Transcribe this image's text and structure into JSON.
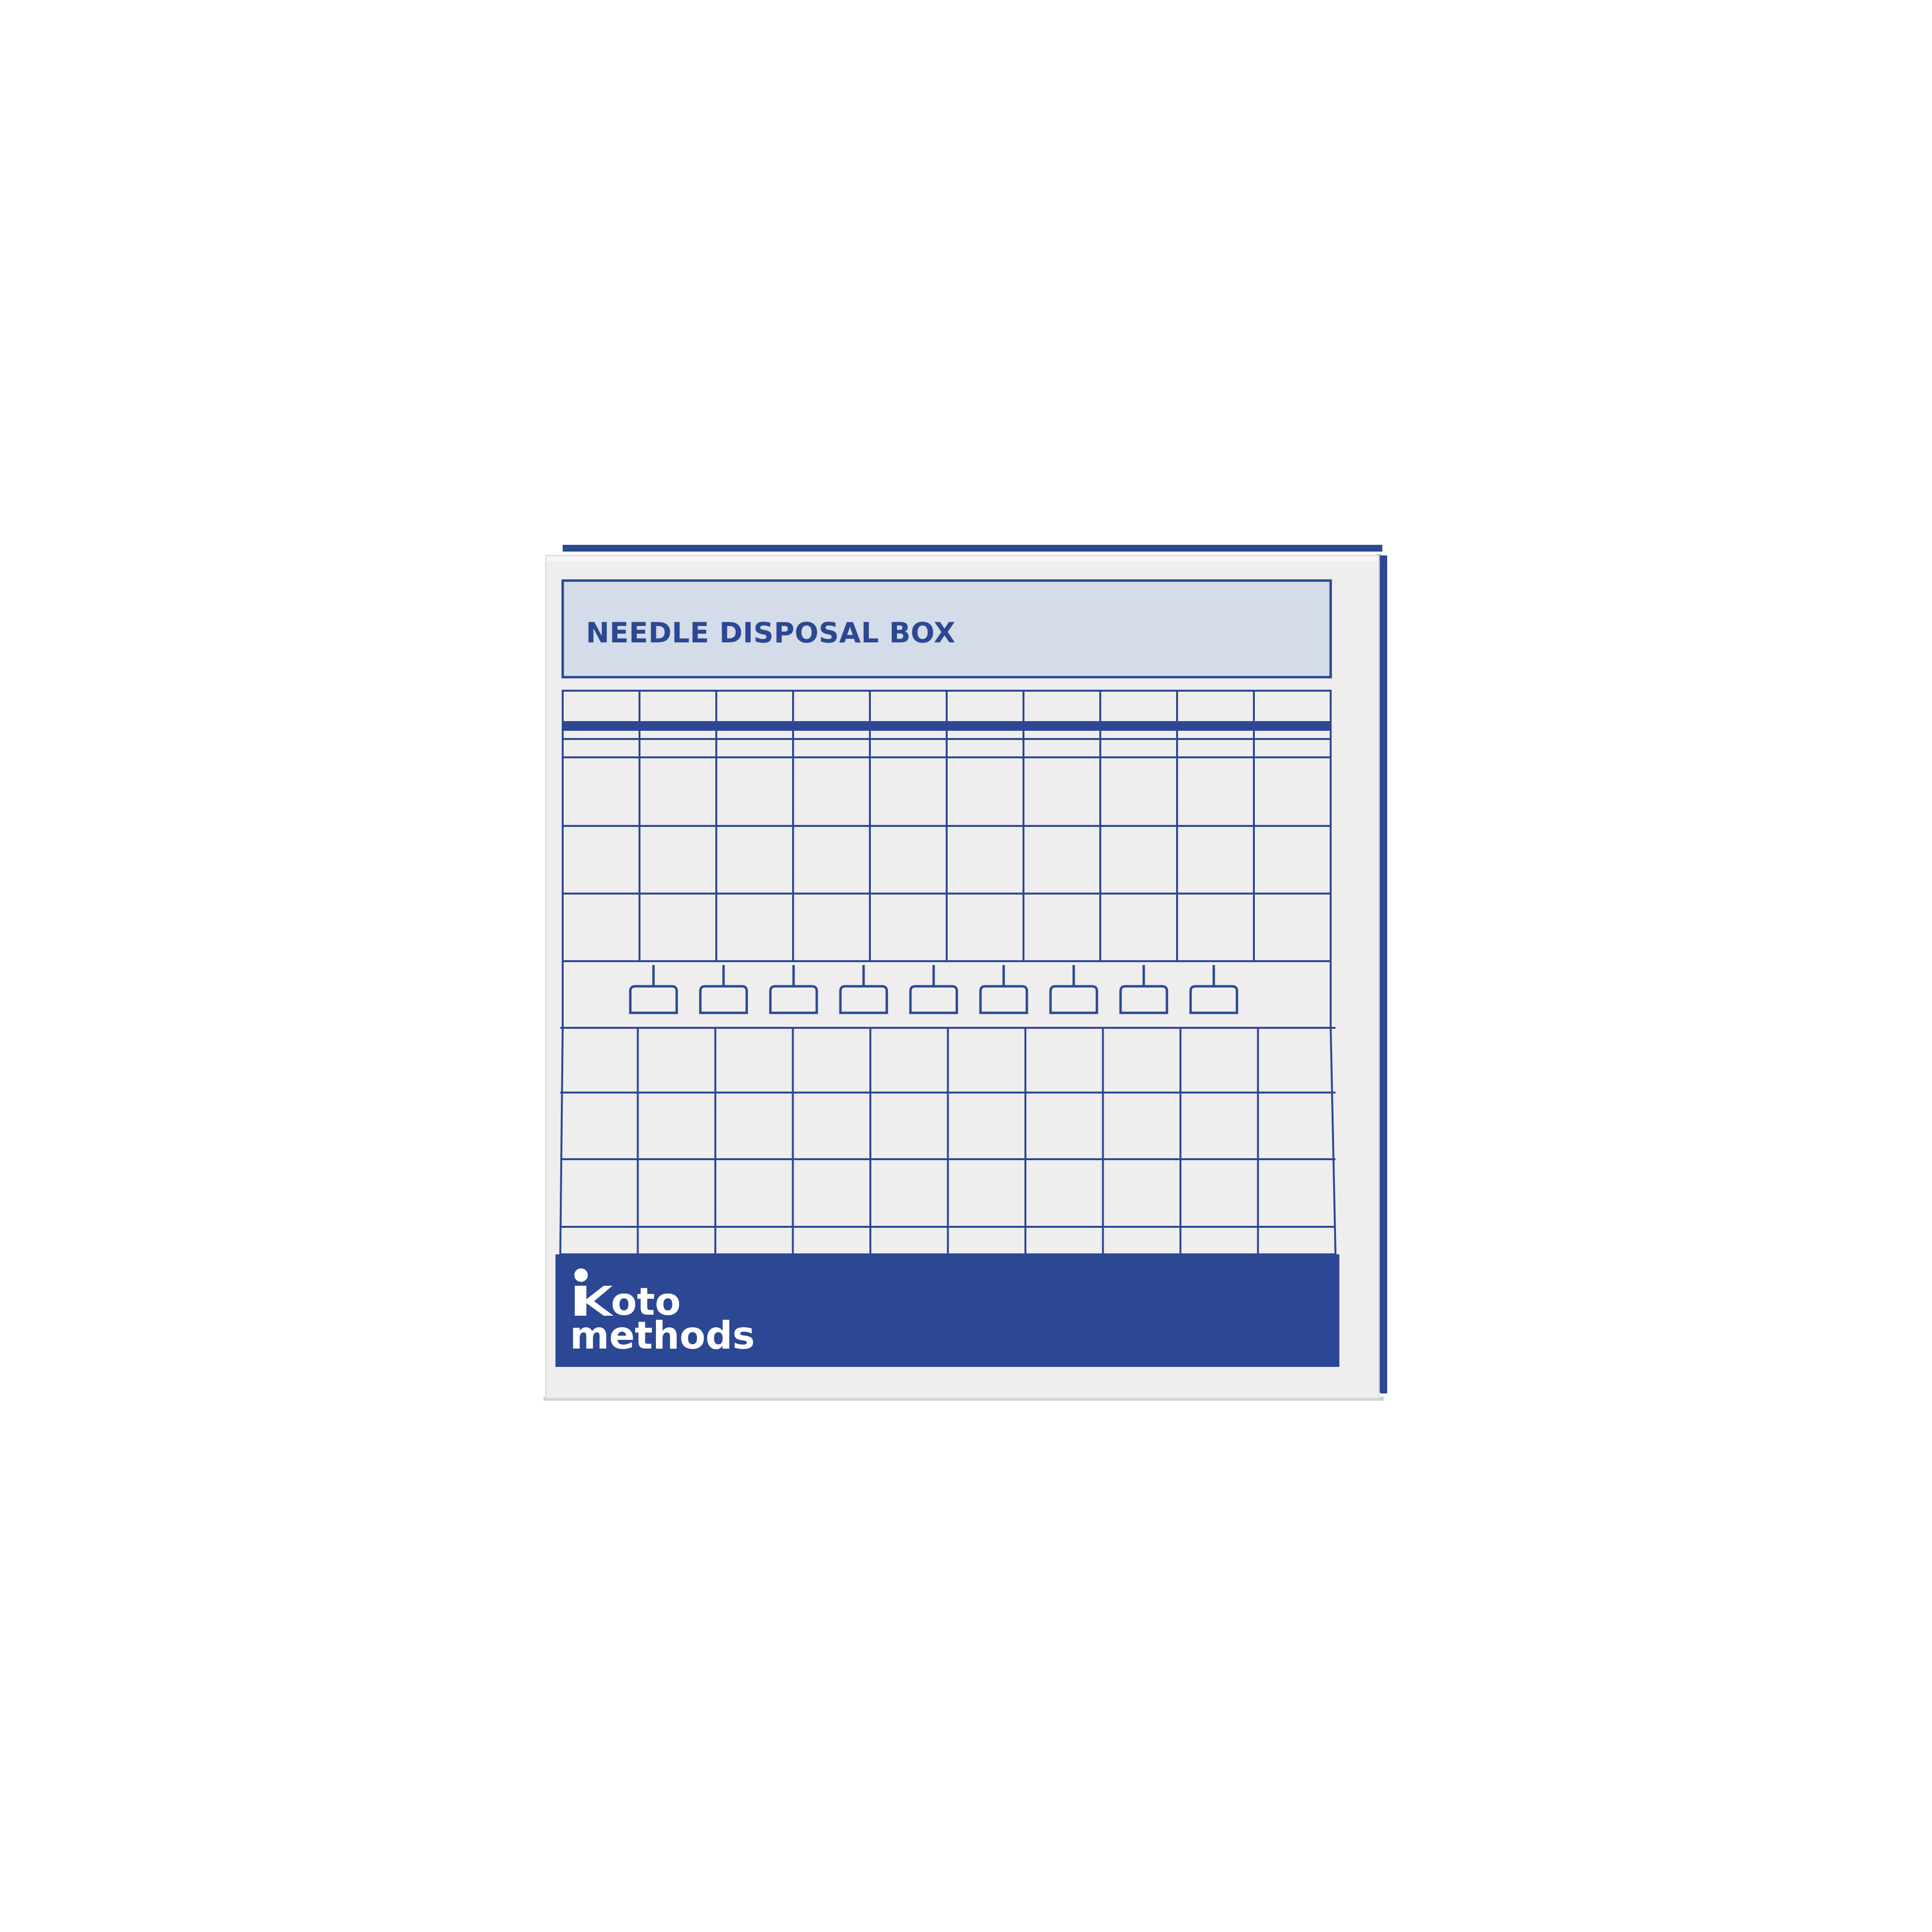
{
  "product": {
    "title": "NEEDLE DISPOSAL BOX",
    "brand_line1": "oto",
    "brand_line2": "methods",
    "brand_mark": "person-k-logo"
  },
  "grid": {
    "columns": 10,
    "upper_rows": 3,
    "lower_rows": 3,
    "needle_slots": 9
  },
  "colors": {
    "brand_blue": "#2c4894",
    "header_fill": "#d3dce8",
    "card_fill": "#efeded",
    "edge_fill": "#ffffff"
  }
}
